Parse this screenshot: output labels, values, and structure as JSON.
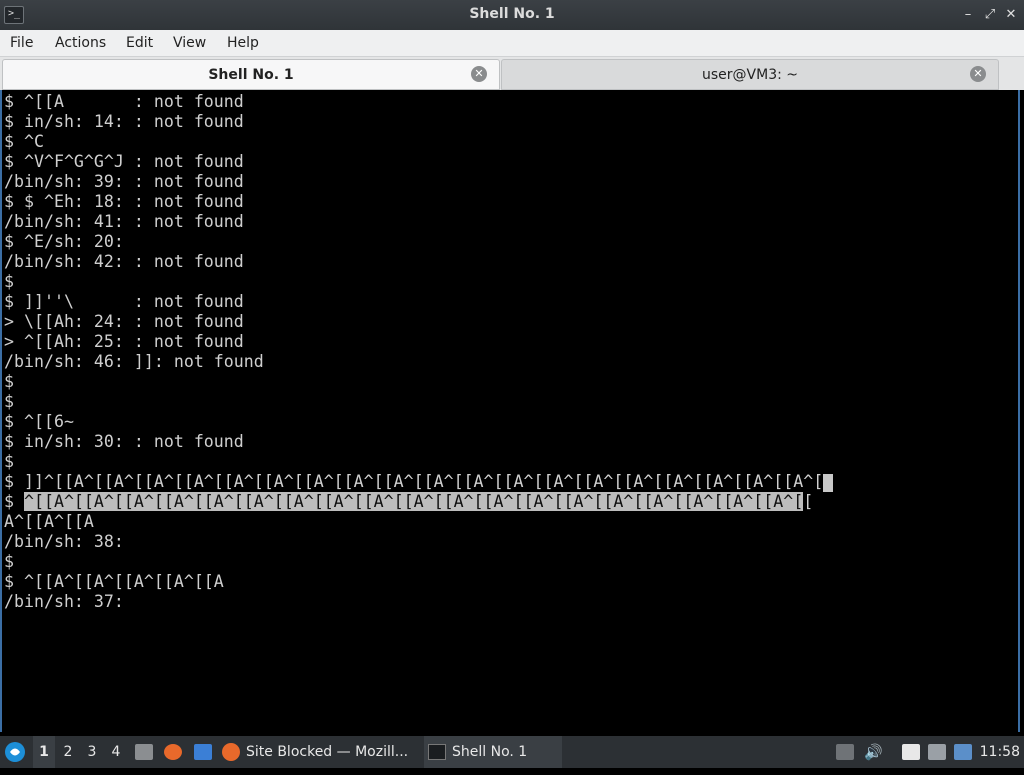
{
  "window": {
    "title": "Shell No. 1",
    "controls": {
      "minimize": "–",
      "maximize": "⤢",
      "close": "✕"
    }
  },
  "menu": [
    "File",
    "Actions",
    "Edit",
    "View",
    "Help"
  ],
  "tabs": [
    {
      "label": "Shell No. 1",
      "active": true
    },
    {
      "label": "user@VM3: ~",
      "active": false
    }
  ],
  "terminal": {
    "lines": [
      "$ ^[[A       : not found",
      "$ in/sh: 14: : not found",
      "$ ^C",
      "$ ^V^F^G^G^J : not found",
      "/bin/sh: 39: : not found",
      "$ $ ^Eh: 18: : not found",
      "/bin/sh: 41: : not found",
      "$ ^E/sh: 20:",
      "/bin/sh: 42: : not found",
      "",
      "$",
      "$ ]]''\\      : not found",
      "> \\[[Ah: 24: : not found",
      "> ^[[Ah: 25: : not found",
      "/bin/sh: 46: ]]: not found",
      "$",
      "",
      "$",
      "$ ^[[6~",
      "$ in/sh: 30: : not found",
      "$",
      "$ ]]^[[A^[[A^[[A^[[A^[[A^[[A^[[A^[[A^[[A^[[A^[[A^[[A^[[A^[[A^[[A^[[A^[[A^[[A^[[A^[",
      "",
      "$ ",
      "A^[[A^[[A",
      "/bin/sh: 38:",
      "$",
      "$ ^[[A^[[A^[[A^[[A^[[A",
      "/bin/sh: 37:"
    ],
    "highlighted_line": "^[[A^[[A^[[A^[[A^[[A^[[A^[[A^[[A^[[A^[[A^[[A^[[A^[[A^[[A^[[A^[[A^[[A^[[A^[[A^[",
    "highlighted_tail": "["
  },
  "taskbar": {
    "workspaces": [
      "1",
      "2",
      "3",
      "4"
    ],
    "tasks": [
      {
        "label": "Site Blocked — Mozill...",
        "icon": "firefox-icon"
      },
      {
        "label": "Shell No. 1",
        "icon": "terminal-icon"
      }
    ],
    "clock": "11:58"
  }
}
